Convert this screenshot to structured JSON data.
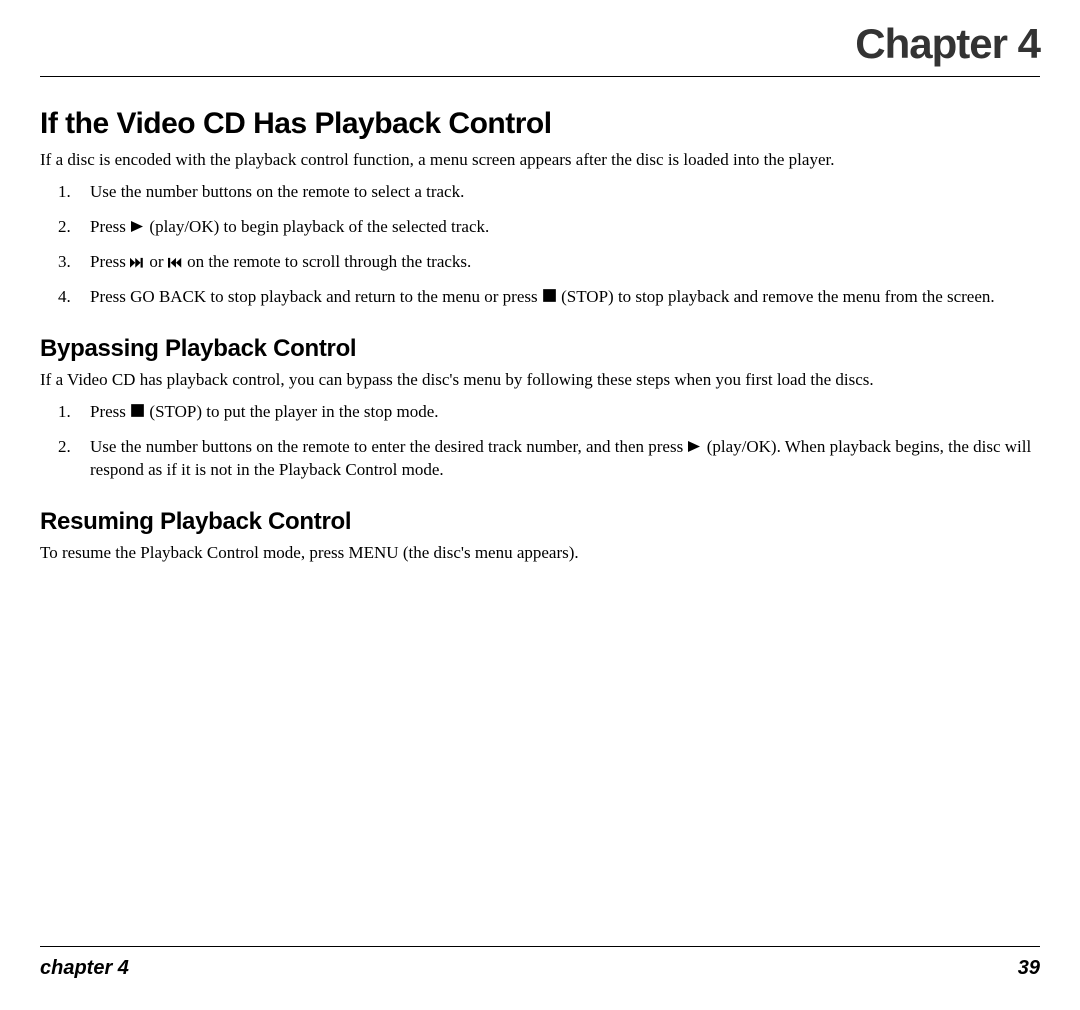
{
  "header": {
    "chapter_label": "Chapter 4"
  },
  "s1": {
    "title": "If the Video CD Has Playback Control",
    "intro": "If a disc is encoded with the playback control function, a menu screen appears after the disc is loaded into the player.",
    "steps": {
      "i1": "Use the number buttons on the remote to select a track.",
      "i2a": "Press ",
      "i2b": " (play/OK) to begin playback of the selected track.",
      "i3a": "Press ",
      "i3b": " or ",
      "i3c": " on the remote to scroll through the tracks.",
      "i4a": "Press GO BACK to stop playback and return to the menu or press ",
      "i4b": " (STOP) to stop playback and remove the menu from the screen."
    }
  },
  "s2": {
    "title": "Bypassing Playback Control",
    "intro": "If a Video CD has playback control, you can bypass the disc's menu by following these steps when you first load the discs.",
    "steps": {
      "i1a": "Press ",
      "i1b": " (STOP) to put the player in the stop mode.",
      "i2a": "Use the number buttons on the remote to enter the desired track number, and then press ",
      "i2b": " (play/OK). When playback begins, the disc will respond as if it is not in the Playback Control mode."
    }
  },
  "s3": {
    "title": "Resuming Playback Control",
    "body": "To resume the Playback Control mode, press MENU (the disc's menu appears)."
  },
  "footer": {
    "left": "chapter 4",
    "right": "39"
  }
}
